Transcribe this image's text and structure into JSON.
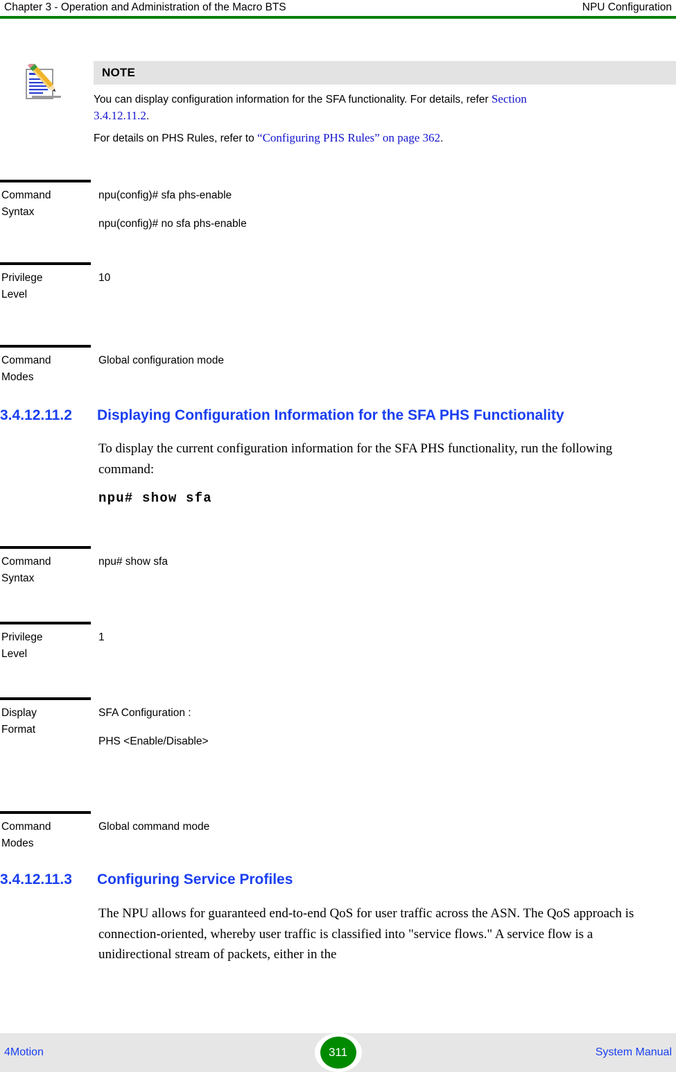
{
  "header": {
    "left": "Chapter 3 - Operation and Administration of the Macro BTS",
    "right": "NPU Configuration",
    "rule_color": "#007f00"
  },
  "note": {
    "icon": "notepad-pencil-icon",
    "label": "NOTE",
    "bar_color": "#e3e3e3",
    "line1_prefix": "You can display configuration information for the SFA functionality. For details, refer ",
    "line1_link": "Section 3.4.12.11.2",
    "line1_suffix": ".",
    "line2_prefix": "For details on PHS Rules, refer to ",
    "line2_link": "“Configuring PHS Rules” on page 362",
    "line2_suffix": ".",
    "link_color": "#1414cf"
  },
  "tables": [
    {
      "rows": [
        {
          "label_line1": "Command",
          "label_line2": "Syntax",
          "values": [
            "npu(config)# sfa phs-enable",
            "npu(config)# no sfa phs-enable"
          ]
        }
      ]
    },
    {
      "rows": [
        {
          "label_line1": "Privilege",
          "label_line2": "Level",
          "values": [
            "10"
          ]
        }
      ]
    },
    {
      "rows": [
        {
          "label_line1": "Command",
          "label_line2": "Modes",
          "values": [
            "Global configuration mode"
          ]
        }
      ]
    },
    {
      "rows": [
        {
          "label_line1": "Command",
          "label_line2": "Syntax",
          "values": [
            "npu# show sfa"
          ]
        }
      ]
    },
    {
      "rows": [
        {
          "label_line1": "Privilege",
          "label_line2": "Level",
          "values": [
            "1"
          ]
        }
      ]
    },
    {
      "rows": [
        {
          "label_line1": "Display",
          "label_line2": "Format",
          "values": [
            "SFA Configuration :",
            "PHS <Enable/Disable>"
          ]
        }
      ]
    },
    {
      "rows": [
        {
          "label_line1": "Command",
          "label_line2": "Modes",
          "values": [
            "Global command mode"
          ]
        }
      ]
    }
  ],
  "sections": [
    {
      "number": "3.4.12.11.2",
      "title": "Displaying Configuration Information for the SFA PHS Functionality",
      "paragraph": "To display the current configuration information for the SFA PHS functionality, run the following command:",
      "code": "npu# show sfa"
    },
    {
      "number": "3.4.12.11.3",
      "title": "Configuring Service Profiles",
      "paragraph": "The NPU allows for guaranteed end-to-end QoS for user traffic across the ASN. The QoS approach is connection-oriented, whereby user traffic is classified into \"service flows.\" A service flow is a unidirectional stream of packets, either in the"
    }
  ],
  "footer": {
    "left": "4Motion",
    "page_number": "311",
    "right": "System Manual",
    "badge_color": "#008a00",
    "background": "#e6e6e6"
  }
}
